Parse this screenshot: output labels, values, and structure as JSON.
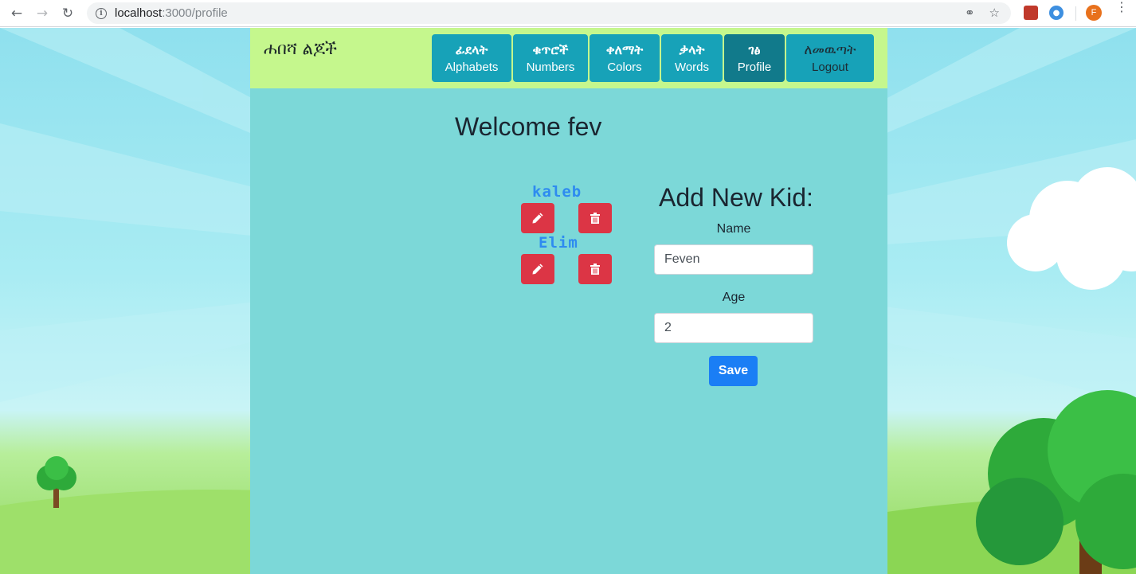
{
  "browser": {
    "url_host": "localhost",
    "url_path": ":3000/profile",
    "profile_initial": "F"
  },
  "header": {
    "brand": "ሐበሻ ልጆች",
    "nav": [
      {
        "amharic": "ፊደላት",
        "english": "Alphabets"
      },
      {
        "amharic": "ቁጥሮች",
        "english": "Numbers"
      },
      {
        "amharic": "ቀለማት",
        "english": "Colors"
      },
      {
        "amharic": "ቃላት",
        "english": "Words"
      },
      {
        "amharic": "ገፅ",
        "english": "Profile",
        "active": true
      },
      {
        "amharic": "ለመዉጣት",
        "english": "Logout"
      }
    ]
  },
  "main": {
    "welcome": "Welcome fev",
    "kids": [
      {
        "name": "kaleb"
      },
      {
        "name": "Elim"
      }
    ],
    "form": {
      "title": "Add New Kid:",
      "name_label": "Name",
      "name_value": "Feven",
      "age_label": "Age",
      "age_value": "2",
      "save_label": "Save"
    }
  },
  "colors": {
    "topbar": "#c5f78d",
    "panel": "#7cd8d8",
    "nav_tab": "#17a2b8",
    "nav_tab_active": "#117a8b",
    "danger": "#dc3545",
    "primary": "#1a7ef5"
  }
}
